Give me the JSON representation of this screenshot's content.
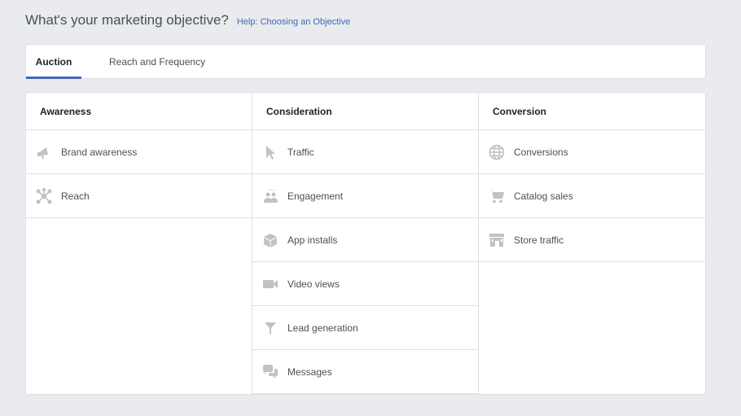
{
  "header": {
    "title": "What's your marketing objective?",
    "help_link": "Help: Choosing an Objective"
  },
  "tabs": [
    {
      "label": "Auction",
      "active": true
    },
    {
      "label": "Reach and Frequency",
      "active": false
    }
  ],
  "columns": [
    {
      "heading": "Awareness",
      "items": [
        {
          "label": "Brand awareness",
          "icon": "megaphone-icon"
        },
        {
          "label": "Reach",
          "icon": "network-icon"
        }
      ]
    },
    {
      "heading": "Consideration",
      "items": [
        {
          "label": "Traffic",
          "icon": "cursor-icon"
        },
        {
          "label": "Engagement",
          "icon": "people-icon"
        },
        {
          "label": "App installs",
          "icon": "box-icon"
        },
        {
          "label": "Video views",
          "icon": "video-camera-icon"
        },
        {
          "label": "Lead generation",
          "icon": "funnel-icon"
        },
        {
          "label": "Messages",
          "icon": "chat-bubbles-icon"
        }
      ]
    },
    {
      "heading": "Conversion",
      "items": [
        {
          "label": "Conversions",
          "icon": "globe-icon"
        },
        {
          "label": "Catalog sales",
          "icon": "shopping-cart-icon"
        },
        {
          "label": "Store traffic",
          "icon": "storefront-icon"
        }
      ]
    }
  ],
  "colors": {
    "accent": "#4267b2",
    "icon": "#bec3c9",
    "background": "#e9ebee"
  }
}
